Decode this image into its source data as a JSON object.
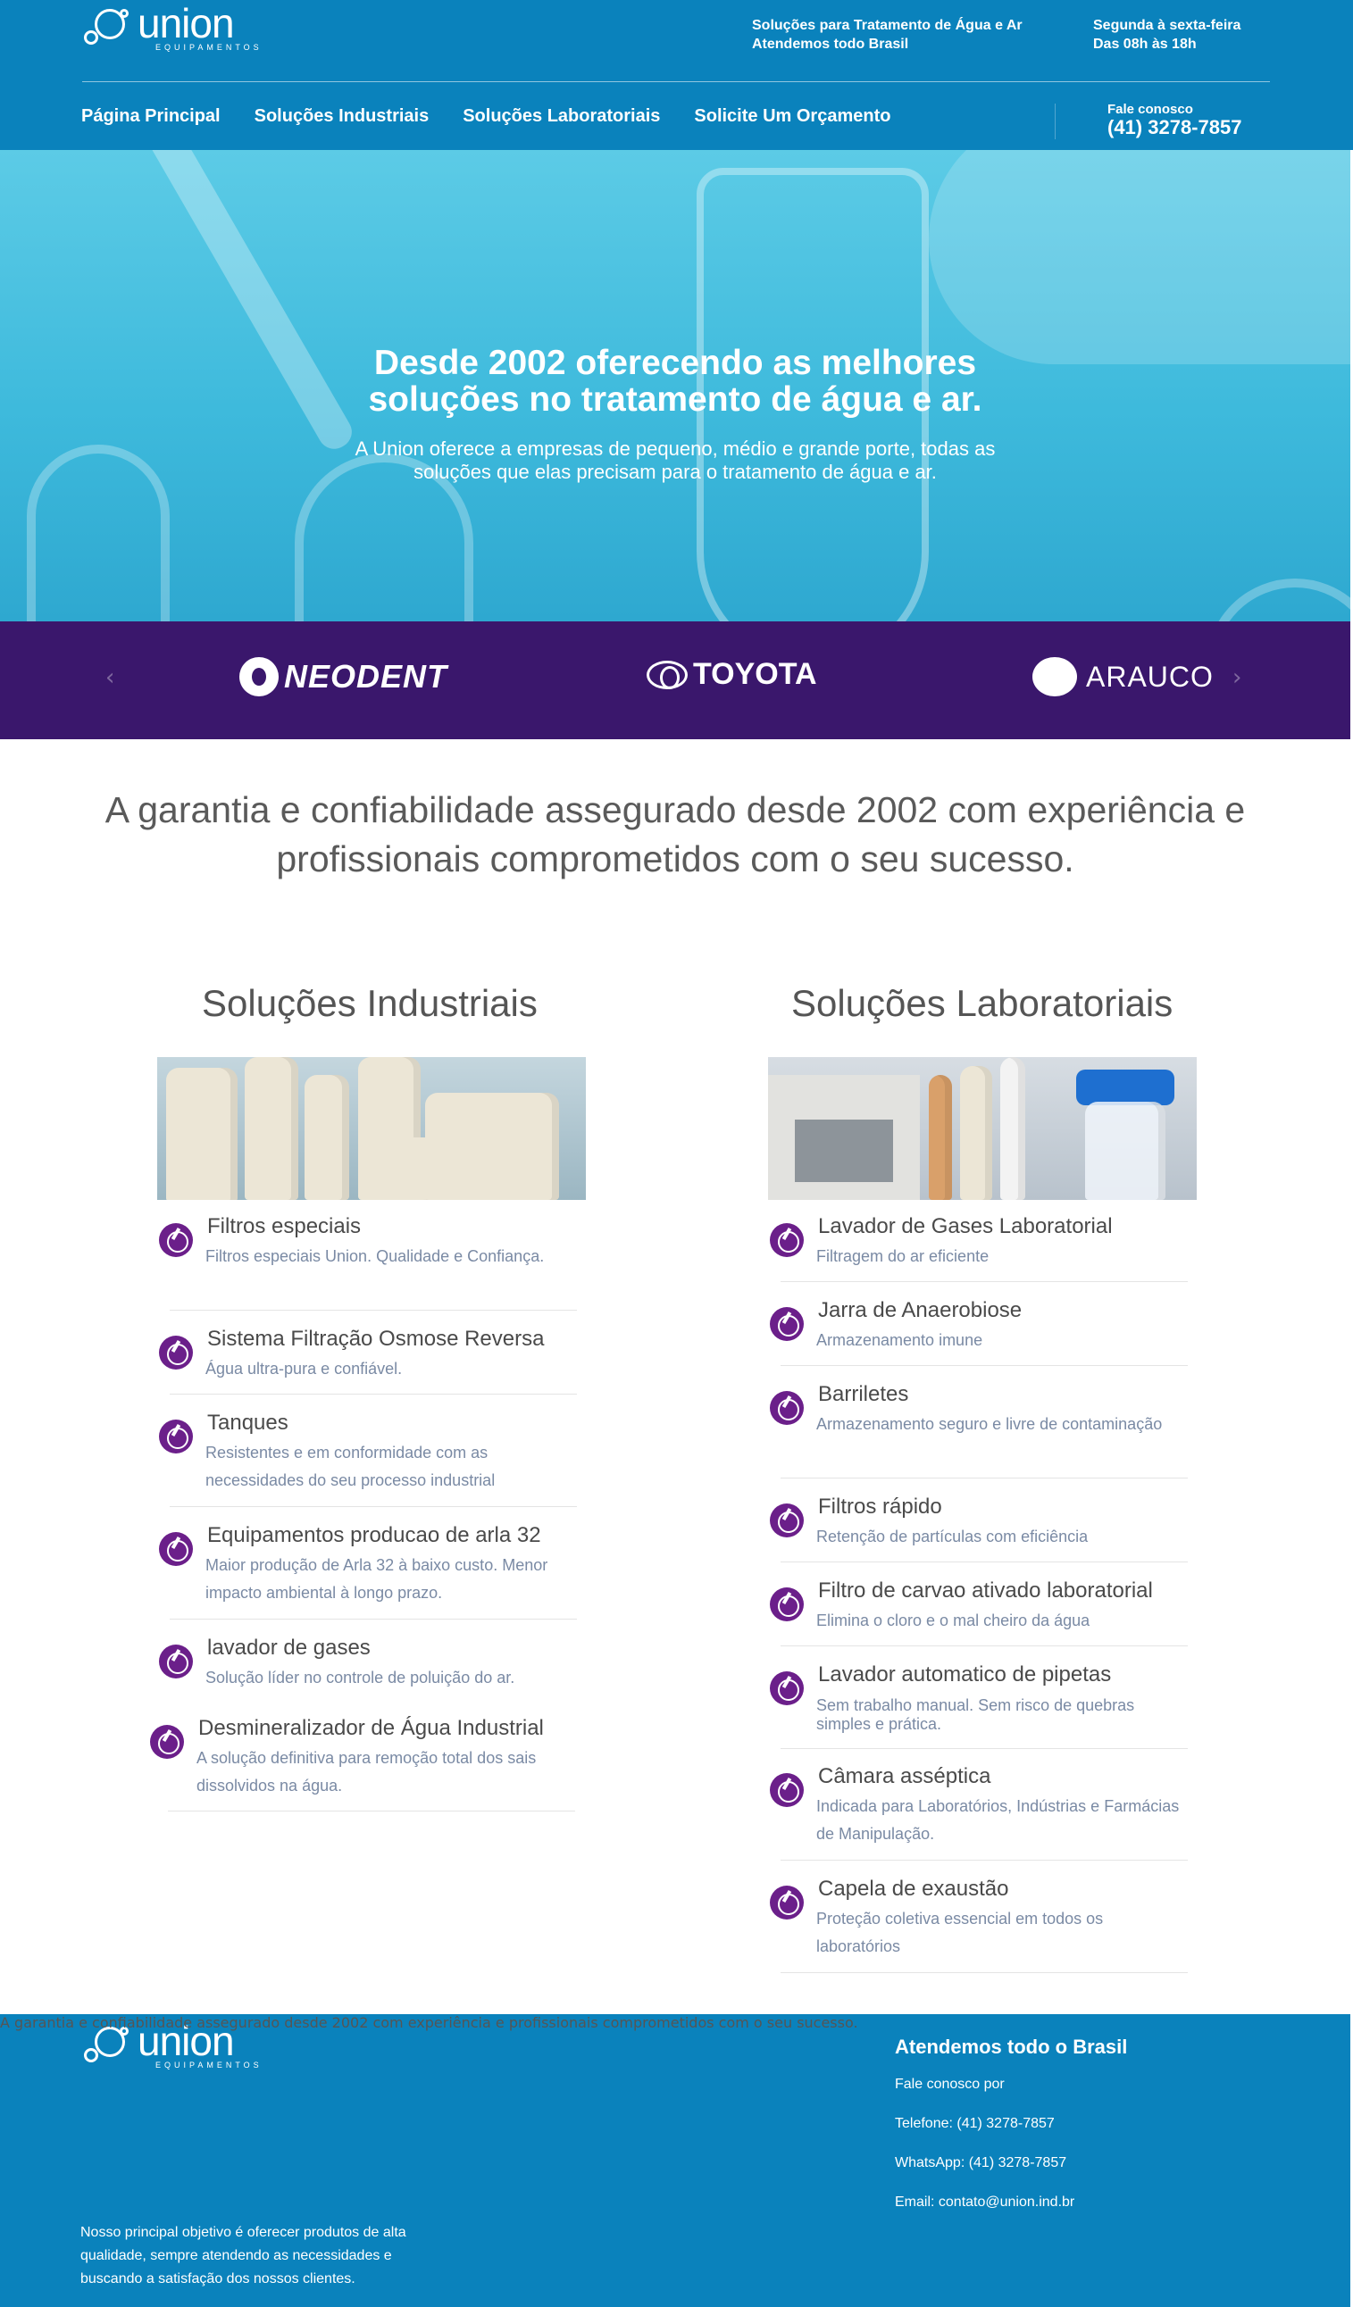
{
  "brand": {
    "name": "union",
    "tagline": "EQUIPAMENTOS"
  },
  "header": {
    "info_a": [
      "Soluções para Tratamento de Água e Ar",
      "Atendemos todo Brasil"
    ],
    "info_b": [
      "Segunda à sexta-feira",
      "Das 08h às 18h"
    ],
    "nav": [
      "Página Principal",
      "Soluções Industriais",
      "Soluções Laboratoriais",
      "Solicite Um Orçamento"
    ],
    "contact_label": "Fale conosco",
    "contact_phone": "(41) 3278-7857"
  },
  "hero": {
    "title_1": "Desde 2002 oferecendo as melhores",
    "title_2": "soluções no tratamento de água e ar.",
    "subtitle_1": "A Union oferece a empresas de pequeno, médio e grande porte, todas as",
    "subtitle_2": "soluções que elas precisam para o tratamento de água e ar."
  },
  "clients": {
    "prev": "‹",
    "next": "›",
    "logos": [
      "NEODENT",
      "TOYOTA",
      "ARAUCO"
    ]
  },
  "tagline_1": "A garantia e confiabilidade assegurado desde 2002 com experiência e",
  "tagline_2": "profissionais comprometidos com o seu sucesso.",
  "industrial": {
    "title": "Soluções Industriais",
    "items": [
      {
        "title": "Filtros especiais",
        "desc": "Filtros especiais Union. Qualidade e Confiança."
      },
      {
        "title": "Sistema Filtração Osmose Reversa",
        "desc": "Água ultra-pura e confiável."
      },
      {
        "title": "Tanques",
        "desc": "Resistentes e em conformidade com as necessidades do seu processo industrial"
      },
      {
        "title": "Equipamentos producao de arla 32",
        "desc": "Maior produção de Arla 32 à baixo custo. Menor impacto ambiental à longo prazo."
      },
      {
        "title": "lavador de gases",
        "desc": "Solução líder no controle de poluição do ar."
      },
      {
        "title": "Desmineralizador de Água Industrial",
        "desc": "A solução definitiva para remoção total dos sais dissolvidos na água."
      }
    ]
  },
  "laboratory": {
    "title": "Soluções Laboratoriais",
    "items": [
      {
        "title": "Lavador de Gases Laboratorial",
        "desc": "Filtragem do ar eficiente"
      },
      {
        "title": "Jarra de Anaerobiose",
        "desc": "Armazenamento imune"
      },
      {
        "title": "Barriletes",
        "desc": "Armazenamento seguro e livre de contaminação"
      },
      {
        "title": "Filtros rápido",
        "desc": "Retenção de partículas com eficiência"
      },
      {
        "title": "Filtro de carvao ativado laboratorial",
        "desc": "Elimina o cloro e o mal cheiro da água"
      },
      {
        "title": "Lavador automatico de pipetas",
        "desc": "Sem trabalho manual. Sem risco de quebras simples e prática."
      },
      {
        "title": "Câmara asséptica",
        "desc": "Indicada para Laboratórios, Indústrias e Farmácias de Manipulação."
      },
      {
        "title": "Capela de exaustão",
        "desc": "Proteção coletiva essencial em todos os laboratórios"
      }
    ]
  },
  "footer": {
    "bold_text": "A garantia e confiabilidade assegurado desde 2002 com experiência e profissionais comprometidos com o seu sucesso.",
    "text": "Nosso principal objetivo é oferecer produtos de alta qualidade, sempre atendendo as necessidades e buscando a satisfação dos nossos clientes.",
    "heading": "Atendemos todo o Brasil",
    "lines": [
      "Fale conosco por",
      "Telefone: (41) 3278-7857",
      "WhatsApp: (41) 3278-7857",
      "Email: contato@union.ind.br"
    ]
  },
  "colors": {
    "primary": "#0A82BC",
    "purple": "#3A176C",
    "icon": "#6b1f8a"
  }
}
